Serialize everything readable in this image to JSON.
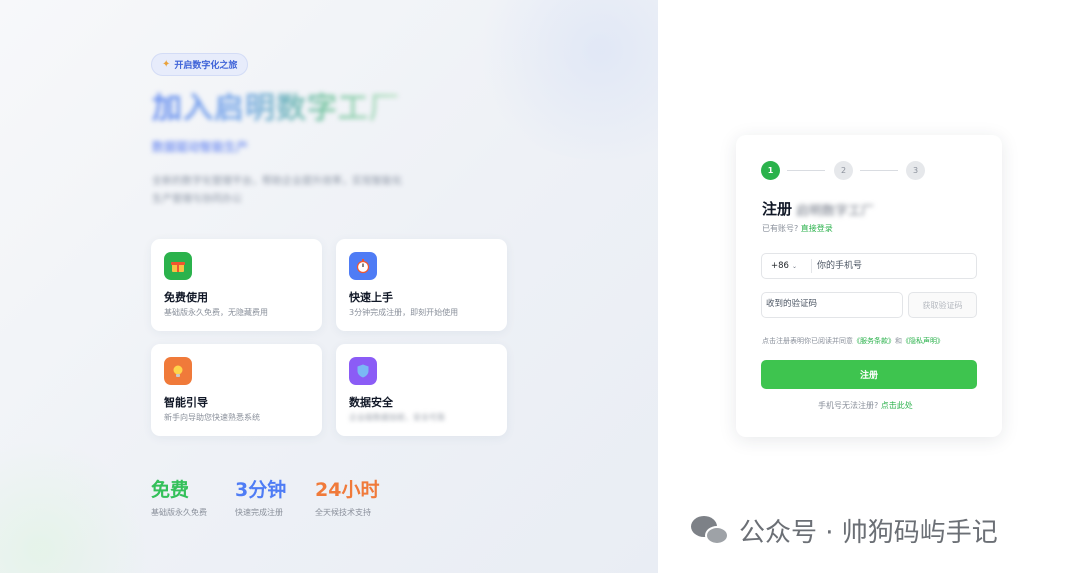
{
  "left": {
    "pill_text": "开启数字化之旅",
    "headline": "加入启明数字工厂",
    "subheadline": "数据驱动智能生产",
    "description": "全新的数字化管理平台，帮助企业提升效率，实现智能化生产管理与协同办公",
    "features": [
      {
        "title": "免费使用",
        "desc": "基础版永久免费，无隐藏费用",
        "icon": "gift-icon",
        "color": "#2bb24c"
      },
      {
        "title": "快速上手",
        "desc": "3分钟完成注册，即刻开始使用",
        "icon": "stopwatch-icon",
        "color": "#4f7cf5"
      },
      {
        "title": "智能引导",
        "desc": "新手向导助您快速熟悉系统",
        "icon": "lightbulb-icon",
        "color": "#f07a3a"
      },
      {
        "title": "数据安全",
        "desc": "企业级数据加密，安全可靠",
        "icon": "shield-icon",
        "color": "#8b5cf6"
      }
    ],
    "stats": [
      {
        "value": "免费",
        "label": "基础版永久免费",
        "color": "#34c05a"
      },
      {
        "value": "3分钟",
        "label": "快速完成注册",
        "color": "#4f7cf5"
      },
      {
        "value": "24小时",
        "label": "全天候技术支持",
        "color": "#f07a3a"
      }
    ]
  },
  "form": {
    "steps": [
      "1",
      "2",
      "3"
    ],
    "title": "注册",
    "title_suffix": "启明数字工厂",
    "has_account": "已有账号?",
    "login_link": "直接登录",
    "country_code": "+86",
    "phone_placeholder": "你的手机号",
    "code_placeholder": "收到的验证码",
    "get_code": "获取验证码",
    "agreement_prefix": "点击注册表明你已阅读并同意",
    "terms": "《服务条款》",
    "and": "和",
    "privacy": "《隐私声明》",
    "register_button": "注册",
    "cant_register": "手机号无法注册?",
    "click_here": "点击此处"
  },
  "watermark": {
    "text": "公众号 · 帅狗码屿手记"
  }
}
